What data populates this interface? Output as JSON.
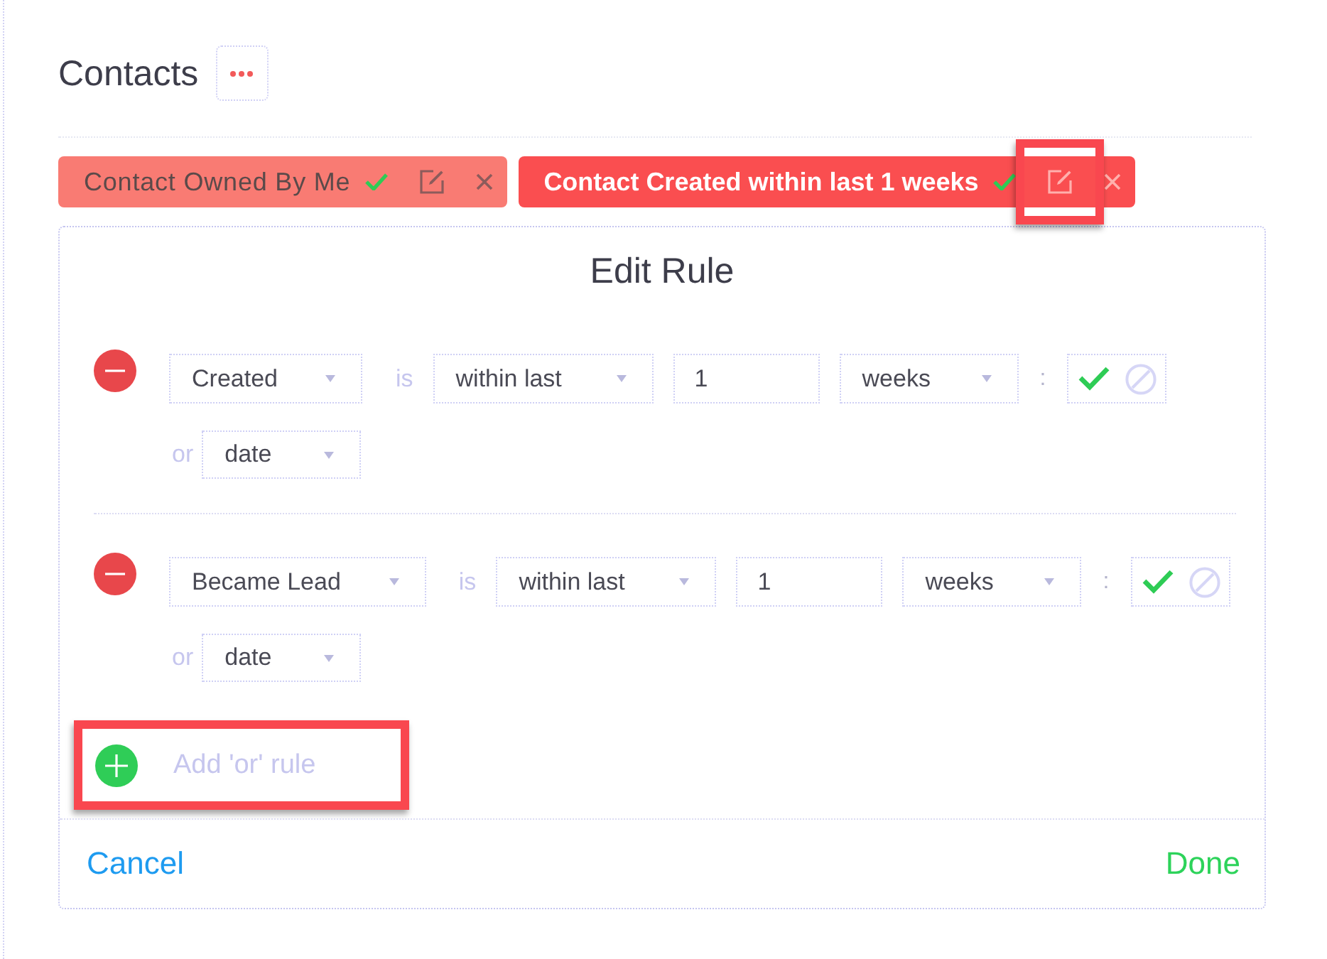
{
  "header": {
    "title": "Contacts"
  },
  "filters": [
    {
      "label": "Contact Owned By Me",
      "selected": false,
      "edit_highlighted": false
    },
    {
      "label": "Contact Created within last 1 weeks",
      "selected": true,
      "edit_highlighted": true
    }
  ],
  "edit_rule": {
    "title": "Edit Rule",
    "rules": [
      {
        "field": "Created",
        "operator_label": "is",
        "operator": "within last",
        "value": "1",
        "unit": "weeks",
        "separator": ":",
        "options": [
          {
            "kind": "include",
            "selected": true
          },
          {
            "kind": "exclude",
            "selected": false
          }
        ],
        "or_label": "or",
        "alt_field": "date"
      },
      {
        "field": "Became Lead",
        "operator_label": "is",
        "operator": "within last",
        "value": "1",
        "unit": "weeks",
        "separator": ":",
        "options": [
          {
            "kind": "include",
            "selected": true
          },
          {
            "kind": "exclude",
            "selected": false
          }
        ],
        "or_label": "or",
        "alt_field": "date"
      }
    ],
    "add_rule": {
      "label": "Add 'or' rule",
      "highlighted": true
    },
    "cancel": "Cancel",
    "done": "Done"
  }
}
